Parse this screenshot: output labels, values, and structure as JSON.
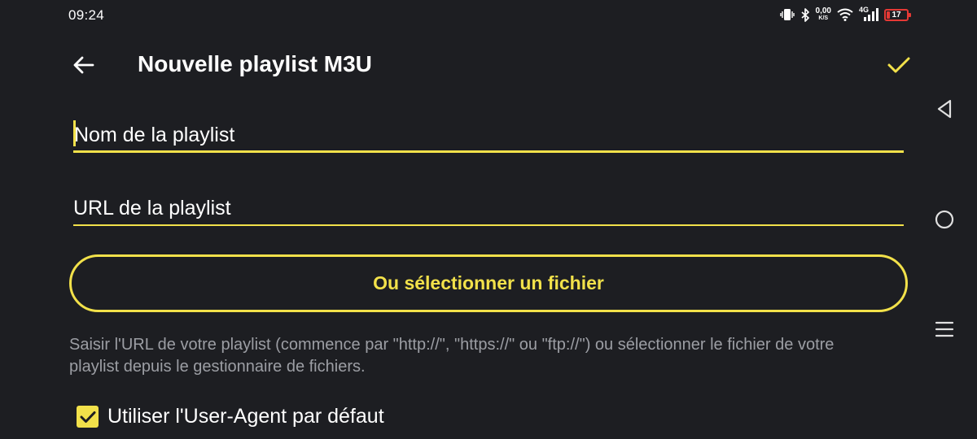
{
  "status_bar": {
    "time": "09:24",
    "speed_value": "0,00",
    "speed_unit": "K/S",
    "network_label": "4G",
    "battery_level": "17",
    "battery_color": "#e53935"
  },
  "header": {
    "title": "Nouvelle playlist M3U",
    "back_icon": "arrow-left-icon",
    "confirm_icon": "check-icon"
  },
  "form": {
    "name_placeholder": "Nom de la playlist",
    "name_value": "",
    "url_placeholder": "URL de la playlist",
    "url_value": "",
    "file_button_label": "Ou sélectionner un fichier",
    "help_text": "Saisir l'URL de votre playlist (commence par \"http://\", \"https://\" ou \"ftp://\") ou sélectionner le fichier de votre playlist depuis le gestionnaire de fichiers.",
    "default_user_agent_label": "Utiliser l'User-Agent par défaut",
    "default_user_agent_checked": true
  },
  "navigation": {
    "back_icon": "triangle-back-icon",
    "home_icon": "circle-home-icon",
    "recents_icon": "menu-lines-icon"
  },
  "colors": {
    "background": "#1d1e22",
    "accent": "#f2e14a",
    "text": "#ffffff",
    "muted_text": "#9c9ea4"
  }
}
